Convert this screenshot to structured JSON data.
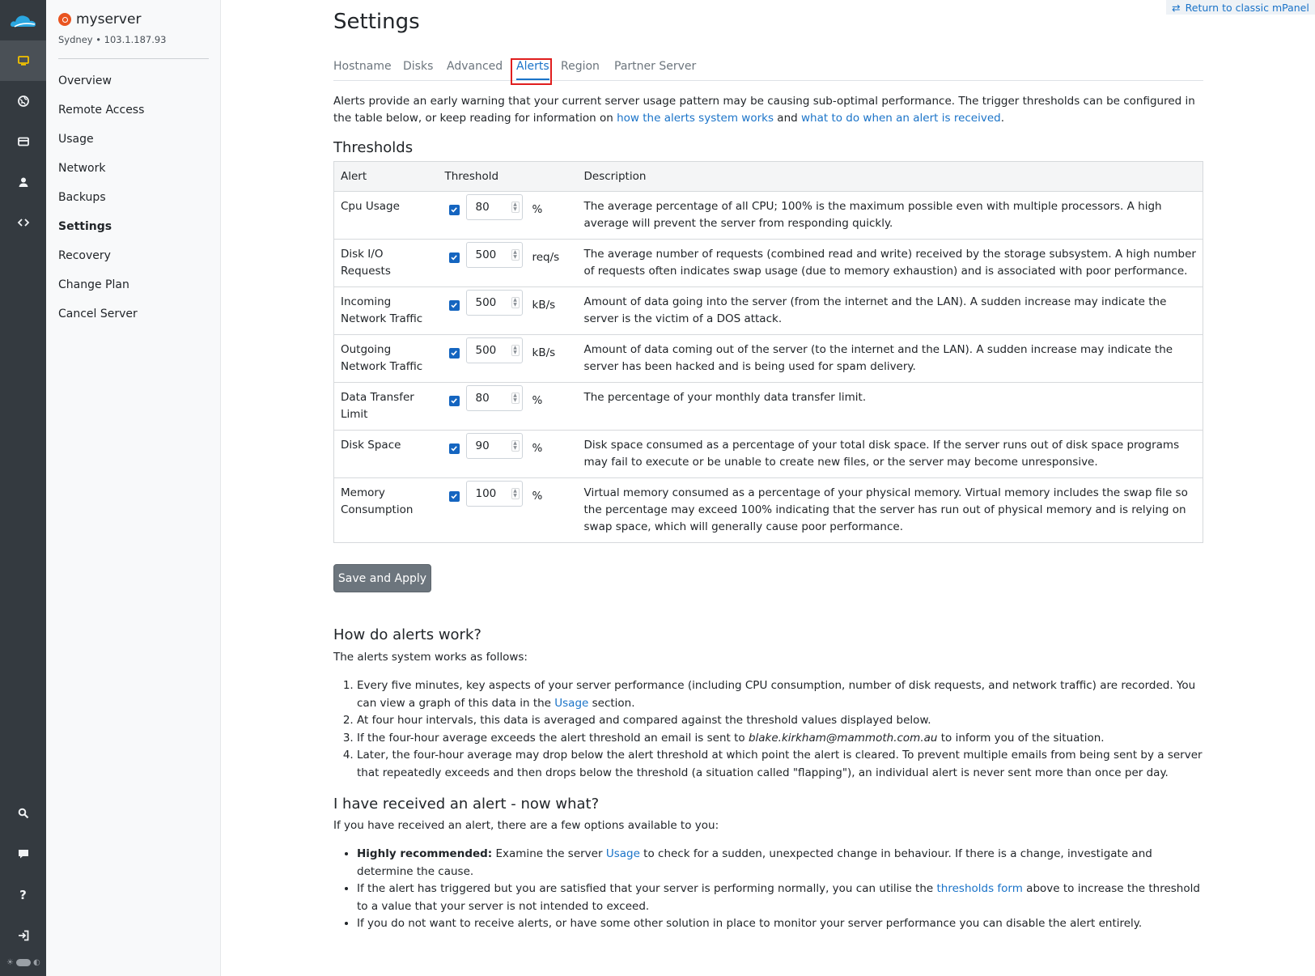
{
  "rail": {
    "items": [
      {
        "icon": "server-icon",
        "active": true
      },
      {
        "icon": "globe-icon",
        "active": false
      },
      {
        "icon": "card-icon",
        "active": false
      },
      {
        "icon": "user-icon",
        "active": false
      },
      {
        "icon": "code-icon",
        "active": false
      }
    ],
    "bottom_items": [
      "search-icon",
      "chat-icon",
      "help-icon",
      "logout-icon"
    ]
  },
  "server": {
    "name": "myserver",
    "location": "Sydney • 103.1.187.93"
  },
  "sidebar": {
    "items": [
      {
        "label": "Overview"
      },
      {
        "label": "Remote Access"
      },
      {
        "label": "Usage"
      },
      {
        "label": "Network"
      },
      {
        "label": "Backups"
      },
      {
        "label": "Settings",
        "current": true
      },
      {
        "label": "Recovery"
      },
      {
        "label": "Change Plan"
      },
      {
        "label": "Cancel Server"
      }
    ]
  },
  "classic_link": "Return to classic mPanel",
  "page_title": "Settings",
  "tabs": [
    {
      "label": "Hostname"
    },
    {
      "label": "Disks"
    },
    {
      "label": "Advanced"
    },
    {
      "label": "Alerts",
      "active": true
    },
    {
      "label": "Region"
    },
    {
      "label": "Partner Server"
    }
  ],
  "intro": {
    "text_a": "Alerts provide an early warning that your current server usage pattern may be causing sub-optimal performance. The trigger thresholds can be configured in the table below, or keep reading for information on ",
    "link_a": "how the alerts system works",
    "text_b": " and ",
    "link_b": "what to do when an alert is received",
    "text_c": "."
  },
  "thresholds": {
    "heading": "Thresholds",
    "headers": {
      "alert": "Alert",
      "threshold": "Threshold",
      "description": "Description"
    },
    "rows": [
      {
        "alert": "Cpu Usage",
        "enabled": true,
        "value": "80",
        "unit": "%",
        "description": "The average percentage of all CPU; 100% is the maximum possible even with multiple processors. A high average will prevent the server from responding quickly."
      },
      {
        "alert": "Disk I/O Requests",
        "enabled": true,
        "value": "500",
        "unit": "req/s",
        "description": "The average number of requests (combined read and write) received by the storage subsystem. A high number of requests often indicates swap usage (due to memory exhaustion) and is associated with poor performance."
      },
      {
        "alert": "Incoming Network Traffic",
        "enabled": true,
        "value": "500",
        "unit": "kB/s",
        "description": "Amount of data going into the server (from the internet and the LAN). A sudden increase may indicate the server is the victim of a DOS attack."
      },
      {
        "alert": "Outgoing Network Traffic",
        "enabled": true,
        "value": "500",
        "unit": "kB/s",
        "description": "Amount of data coming out of the server (to the internet and the LAN). A sudden increase may indicate the server has been hacked and is being used for spam delivery."
      },
      {
        "alert": "Data Transfer Limit",
        "enabled": true,
        "value": "80",
        "unit": "%",
        "description": "The percentage of your monthly data transfer limit."
      },
      {
        "alert": "Disk Space",
        "enabled": true,
        "value": "90",
        "unit": "%",
        "description": "Disk space consumed as a percentage of your total disk space. If the server runs out of disk space programs may fail to execute or be unable to create new files, or the server may become unresponsive."
      },
      {
        "alert": "Memory Consumption",
        "enabled": true,
        "value": "100",
        "unit": "%",
        "description": "Virtual memory consumed as a percentage of your physical memory. Virtual memory includes the swap file so the percentage may exceed 100% indicating that the server has run out of physical memory and is relying on swap space, which will generally cause poor performance."
      }
    ]
  },
  "save_button": "Save and Apply",
  "how": {
    "heading": "How do alerts work?",
    "intro": "The alerts system works as follows:",
    "step1_a": "Every five minutes, key aspects of your server performance (including CPU consumption, number of disk requests, and network traffic) are recorded. You can view a graph of this data in the ",
    "step1_link": "Usage",
    "step1_b": " section.",
    "step2": "At four hour intervals, this data is averaged and compared against the threshold values displayed below.",
    "step3_a": "If the four-hour average exceeds the alert threshold an email is sent to ",
    "step3_email": "blake.kirkham@mammoth.com.au",
    "step3_b": " to inform you of the situation.",
    "step4": "Later, the four-hour average may drop below the alert threshold at which point the alert is cleared. To prevent multiple emails from being sent by a server that repeatedly exceeds and then drops below the threshold (a situation called \"flapping\"), an individual alert is never sent more than once per day."
  },
  "received": {
    "heading": "I have received an alert - now what?",
    "intro": "If you have received an alert, there are a few options available to you:",
    "b1_strong": "Highly recommended:",
    "b1_a": " Examine the server ",
    "b1_link": "Usage",
    "b1_b": " to check for a sudden, unexpected change in behaviour. If there is a change, investigate and determine the cause.",
    "b2_a": "If the alert has triggered but you are satisfied that your server is performing normally, you can utilise the ",
    "b2_link": "thresholds form",
    "b2_b": " above to increase the threshold to a value that your server is not intended to exceed.",
    "b3": "If you do not want to receive alerts, or have some other solution in place to monitor your server performance you can disable the alert entirely."
  }
}
